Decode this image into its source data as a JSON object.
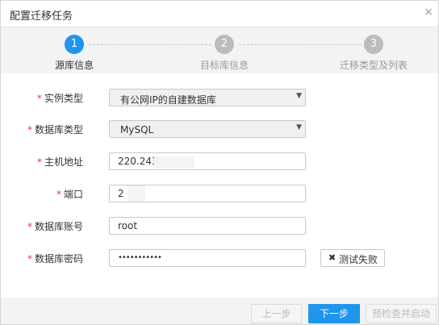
{
  "dialog": {
    "title": "配置迁移任务",
    "close_label": "×"
  },
  "steps": [
    {
      "number": "1",
      "label": "源库信息",
      "state": "active"
    },
    {
      "number": "2",
      "label": "目标库信息",
      "state": "inactive"
    },
    {
      "number": "3",
      "label": "迁移类型及列表",
      "state": "inactive"
    }
  ],
  "form": {
    "required_mark": "*",
    "instance_type": {
      "label": "实例类型",
      "value": "有公网IP的自建数据库"
    },
    "db_type": {
      "label": "数据库类型",
      "value": "MySQL"
    },
    "host": {
      "label": "主机地址",
      "value": "220.243"
    },
    "port": {
      "label": "端口",
      "value": "2"
    },
    "account": {
      "label": "数据库账号",
      "value": "root"
    },
    "password": {
      "label": "数据库密码",
      "value": "•••••••••••"
    },
    "test_button": {
      "icon": "x-icon",
      "label": "测试失败"
    }
  },
  "footer": {
    "prev_label": "上一步",
    "next_label": "下一步",
    "precheck_label": "预检查并启动"
  },
  "colors": {
    "accent": "#1e96ec",
    "required": "#e4393c"
  }
}
